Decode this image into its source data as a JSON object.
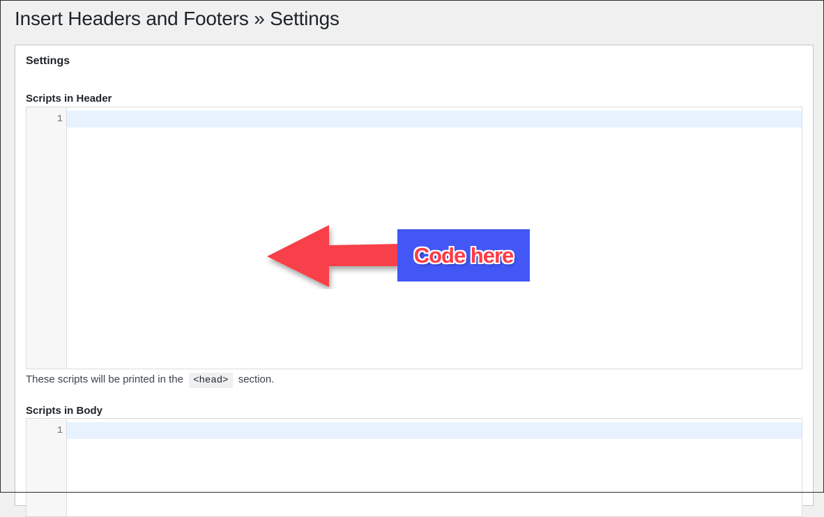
{
  "page": {
    "title": "Insert Headers and Footers » Settings"
  },
  "settings_card": {
    "title": "Settings",
    "header_field": {
      "label": "Scripts in Header",
      "line_number": "1",
      "help_prefix": "These scripts will be printed in the",
      "help_code": "<head>",
      "help_suffix": "section."
    },
    "body_field": {
      "label": "Scripts in Body",
      "line_number": "1"
    }
  },
  "annotation": {
    "label": "Code here",
    "arrow_color": "#f7414a",
    "box_color": "#4257f5"
  },
  "colors": {
    "page_bg": "#f0f0f1",
    "active_line": "#e8f2ff",
    "gutter_bg": "#f7f7f7"
  }
}
